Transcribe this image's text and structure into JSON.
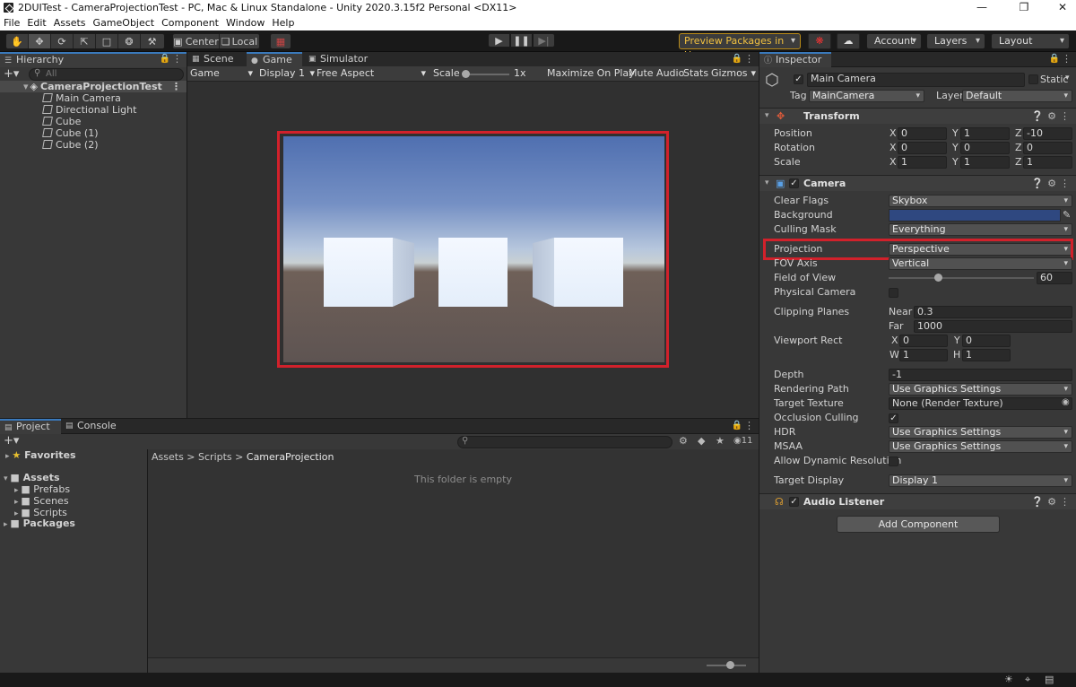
{
  "window": {
    "title": "2DUITest - CameraProjectionTest - PC, Mac & Linux Standalone - Unity 2020.3.15f2 Personal <DX11>"
  },
  "menu": [
    "File",
    "Edit",
    "Assets",
    "GameObject",
    "Component",
    "Window",
    "Help"
  ],
  "toolbar": {
    "pivot": "Center",
    "space": "Local",
    "preview_packages": "Preview Packages in Use",
    "account": "Account",
    "layers": "Layers",
    "layout": "Layout"
  },
  "hierarchy": {
    "tab": "Hierarchy",
    "search_placeholder": "All",
    "scene": "CameraProjectionTest",
    "items": [
      "Main Camera",
      "Directional Light",
      "Cube",
      "Cube (1)",
      "Cube (2)"
    ]
  },
  "game": {
    "tabs": [
      "Scene",
      "Game",
      "Simulator"
    ],
    "display_mode": "Game",
    "display": "Display 1",
    "aspect": "Free Aspect",
    "scale_label": "Scale",
    "scale_value": "1x",
    "maximize": "Maximize On Play",
    "mute": "Mute Audio",
    "stats": "Stats",
    "gizmos": "Gizmos"
  },
  "project": {
    "tabs": [
      "Project",
      "Console"
    ],
    "favorites": "Favorites",
    "assets": "Assets",
    "folders": [
      "Prefabs",
      "Scenes",
      "Scripts"
    ],
    "packages": "Packages",
    "breadcrumb": [
      "Assets",
      "Scripts",
      "CameraProjection"
    ],
    "empty_msg": "This folder is empty",
    "hidden_count": "11"
  },
  "inspector": {
    "tab": "Inspector",
    "object_name": "Main Camera",
    "static": "Static",
    "tag_label": "Tag",
    "tag": "MainCamera",
    "layer_label": "Layer",
    "layer": "Default",
    "transform": {
      "title": "Transform",
      "position_label": "Position",
      "position": [
        "0",
        "1",
        "-10"
      ],
      "rotation_label": "Rotation",
      "rotation": [
        "0",
        "0",
        "0"
      ],
      "scale_label": "Scale",
      "scale": [
        "1",
        "1",
        "1"
      ]
    },
    "camera": {
      "title": "Camera",
      "clear_flags_label": "Clear Flags",
      "clear_flags": "Skybox",
      "background_label": "Background",
      "background_color": "#2f4880",
      "culling_mask_label": "Culling Mask",
      "culling_mask": "Everything",
      "projection_label": "Projection",
      "projection": "Perspective",
      "fov_axis_label": "FOV Axis",
      "fov_axis": "Vertical",
      "fov_label": "Field of View",
      "fov": "60",
      "physical_label": "Physical Camera",
      "clipping_label": "Clipping Planes",
      "near_label": "Near",
      "near": "0.3",
      "far_label": "Far",
      "far": "1000",
      "viewport_label": "Viewport Rect",
      "vx": "0",
      "vy": "0",
      "vw": "1",
      "vh": "1",
      "depth_label": "Depth",
      "depth": "-1",
      "rendering_path_label": "Rendering Path",
      "rendering_path": "Use Graphics Settings",
      "target_texture_label": "Target Texture",
      "target_texture": "None (Render Texture)",
      "occlusion_label": "Occlusion Culling",
      "hdr_label": "HDR",
      "hdr": "Use Graphics Settings",
      "msaa_label": "MSAA",
      "msaa": "Use Graphics Settings",
      "dynres_label": "Allow Dynamic Resolution",
      "target_display_label": "Target Display",
      "target_display": "Display 1"
    },
    "audio_listener": "Audio Listener",
    "add_component": "Add Component"
  },
  "colors": {
    "highlight": "#d1212b",
    "accent": "#3a79bb"
  }
}
